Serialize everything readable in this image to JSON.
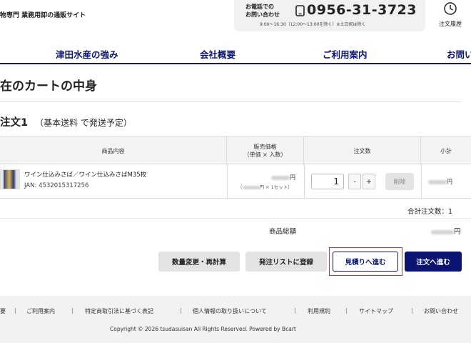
{
  "header": {
    "tagline": "物専門 業務用卸の通販サイト",
    "phone_label": "お電話での\nお問い合わせ",
    "phone_number": "0956-31-3723",
    "phone_hours": "9:00〜16:30（12:00〜13:00を除く）※土日祝は除く",
    "history_label": "注文履歴"
  },
  "nav": {
    "items": [
      "津田水産の強み",
      "会社概要",
      "ご利用案内",
      "お問い"
    ]
  },
  "page": {
    "title": "在のカートの中身",
    "order_title": "注文1",
    "order_subtitle": "（基本送料 で発送予定）"
  },
  "table": {
    "headers": {
      "product": "商品内容",
      "price": "販売価格\n（単価 × 入数）",
      "quantity": "注文数",
      "subtotal": "小計"
    },
    "rows": [
      {
        "name": "ワイン仕込みさば／ワイン仕込みさばM35枚",
        "jan": "JAN: 4532015317256",
        "price_unit": "円",
        "price_detail_suffix": "円 × 1セット）",
        "price_detail_prefix": "（",
        "quantity": "1",
        "minus": "-",
        "plus": "+",
        "delete": "削除",
        "subtotal_unit": "円"
      }
    ]
  },
  "totals": {
    "count_label": "合計注文数：1",
    "sum_label": "商品総額",
    "sum_unit": "円"
  },
  "actions": {
    "recalc": "数量変更・再計算",
    "order_list": "発注リストに登録",
    "estimate": "見積りへ進む",
    "checkout": "注文へ進む"
  },
  "footer": {
    "links": [
      "要",
      "ご利用案内",
      "特定商取引法に基づく表記",
      "個人情報の取り扱いについて",
      "利用規約",
      "サイトマップ",
      "お問い合わせ"
    ],
    "separator": "|",
    "copyright": "Copyright © 2026 tsudasuisan All Rights Reserved. Powered by Bcart"
  },
  "colors": {
    "brand_navy": "#0b1470",
    "highlight_red": "#e0302c",
    "footer_bg": "#f2f2f4"
  },
  "icons": [
    "phone-icon",
    "clock-icon",
    "product-thumbnail"
  ]
}
